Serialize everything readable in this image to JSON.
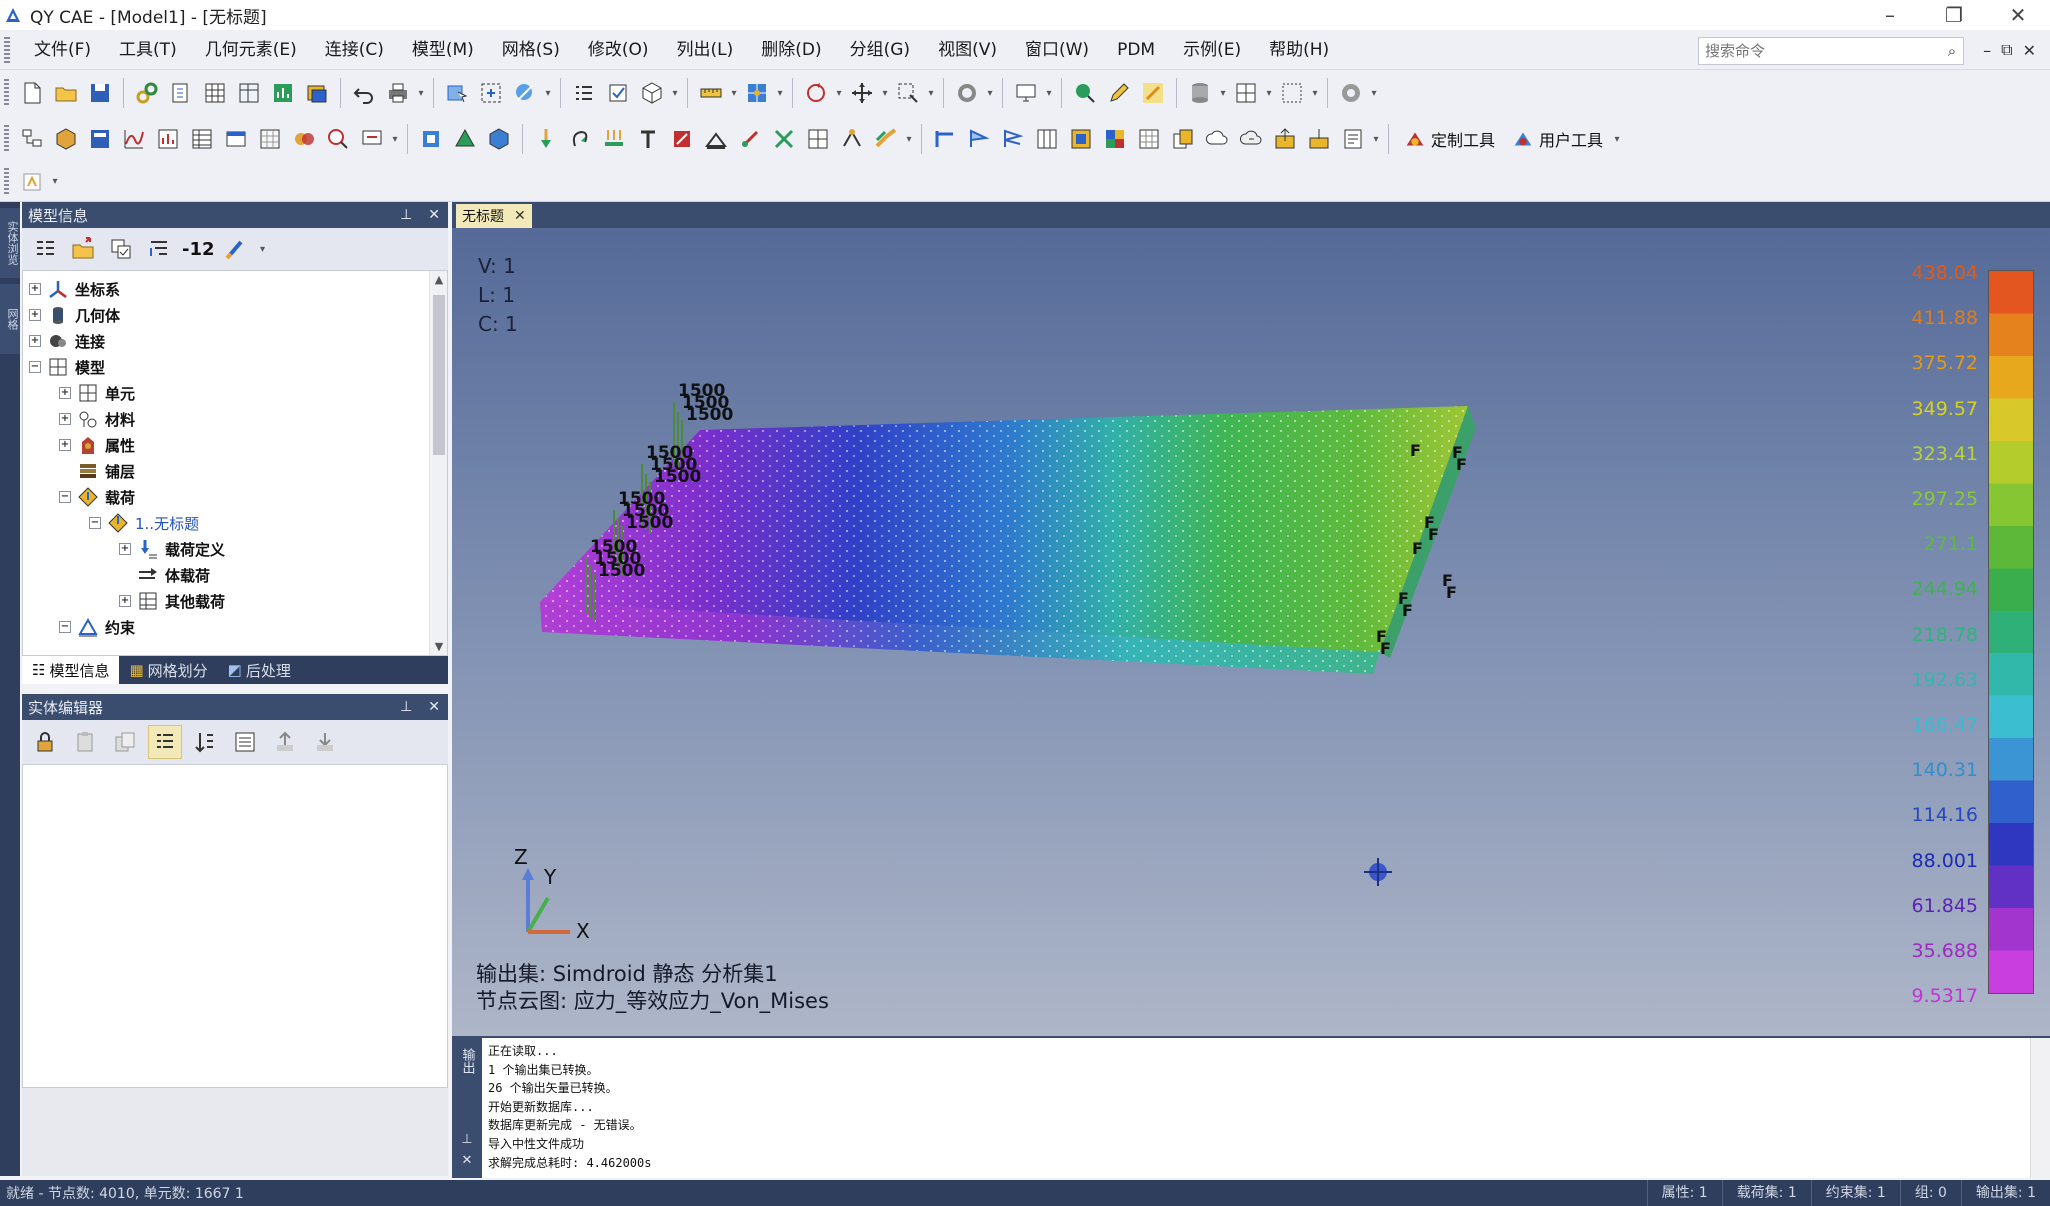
{
  "window": {
    "title": "QY CAE - [Model1] - [无标题]",
    "minimize_glyph": "–",
    "restore_glyph": "❐",
    "close_glyph": "✕"
  },
  "menu": {
    "items": [
      "文件(F)",
      "工具(T)",
      "几何元素(E)",
      "连接(C)",
      "模型(M)",
      "网格(S)",
      "修改(O)",
      "列出(L)",
      "删除(D)",
      "分组(G)",
      "视图(V)",
      "窗口(W)",
      "PDM",
      "示例(E)",
      "帮助(H)"
    ],
    "search_placeholder": "搜索命令",
    "mdi_buttons": [
      "–",
      "⧉",
      "✕"
    ]
  },
  "toolbars": {
    "custom_tools_label": "定制工具",
    "user_tools_label": "用户工具"
  },
  "left_dock": {
    "vtabs": [
      "实体浏览",
      "网格"
    ]
  },
  "model_info": {
    "title": "模型信息",
    "pin": "⊥",
    "close": "✕",
    "toolbar_value": "-12",
    "tree": [
      {
        "label": "坐标系",
        "icon": "axes-icon"
      },
      {
        "label": "几何体",
        "icon": "geometry-icon"
      },
      {
        "label": "连接",
        "icon": "connection-icon"
      },
      {
        "label": "模型",
        "icon": "model-icon"
      },
      {
        "label": "单元",
        "icon": "element-icon"
      },
      {
        "label": "材料",
        "icon": "material-icon"
      },
      {
        "label": "属性",
        "icon": "property-icon"
      },
      {
        "label": "铺层",
        "icon": "layup-icon"
      },
      {
        "label": "载荷",
        "icon": "load-icon"
      },
      {
        "label": "1..无标题",
        "icon": "loadcase-icon"
      },
      {
        "label": "载荷定义",
        "icon": "load-definition-icon"
      },
      {
        "label": "体载荷",
        "icon": "body-load-icon"
      },
      {
        "label": "其他载荷",
        "icon": "other-load-icon"
      },
      {
        "label": "约束",
        "icon": "constraint-icon"
      }
    ],
    "tabs": [
      "模型信息",
      "网格划分",
      "后处理"
    ]
  },
  "entity_editor": {
    "title": "实体编辑器",
    "pin": "⊥",
    "close": "✕"
  },
  "document": {
    "tab_label": "无标题",
    "tab_close": "✕",
    "view_info": [
      "V: 1",
      "L: 1",
      "C: 1"
    ],
    "load_labels": [
      "1500",
      "1500",
      "1500",
      "1500",
      "1500",
      "1500",
      "1500",
      "1500",
      "1500",
      "1500",
      "1500",
      "1500"
    ],
    "triad": {
      "z": "Z",
      "y": "Y",
      "x": "X"
    },
    "output_set": "输出集: Simdroid 静态 分析集1",
    "contour": "节点云图: 应力_等效应力_Von_Mises"
  },
  "legend": {
    "values": [
      "438.04",
      "411.88",
      "375.72",
      "349.57",
      "323.41",
      "297.25",
      "271.1",
      "244.94",
      "218.78",
      "192.63",
      "166.47",
      "140.31",
      "114.16",
      "88.001",
      "61.845",
      "35.688",
      "9.5317"
    ],
    "colors": [
      "#e3561f",
      "#e6821d",
      "#e8a81e",
      "#d9c82a",
      "#b4cd2d",
      "#86c632",
      "#5db83a",
      "#3aae4c",
      "#2fb078",
      "#31b8aa",
      "#3bbfd0",
      "#3b95d4",
      "#3060cc",
      "#2f36c0",
      "#6130c4",
      "#a335cf",
      "#c83ede"
    ],
    "text_colors": [
      "#e15a16",
      "#e07c1a",
      "#e39a18",
      "#d7d21e",
      "#b7d431",
      "#89c935",
      "#58bd3c",
      "#3fb34f",
      "#31b37c",
      "#32b8ad",
      "#37bdd2",
      "#2f8fcf",
      "#2647c0",
      "#1c2ab4",
      "#5c22b6",
      "#9f28c4",
      "#c531d6"
    ]
  },
  "console": {
    "side_labels": [
      "输出",
      "⊥",
      "✕"
    ],
    "lines": [
      "正在读取...",
      "1 个输出集已转换。",
      "26 个输出矢量已转换。",
      "开始更新数据库...",
      "数据库更新完成 - 无错误。",
      "导入中性文件成功",
      "求解完成总耗时: 4.462000s"
    ]
  },
  "status": {
    "left": "就绪 - 节点数: 4010, 单元数: 1667 1",
    "cells": [
      "属性: 1",
      "载荷集: 1",
      "约束集: 1",
      "组: 0",
      "输出集: 1"
    ]
  }
}
